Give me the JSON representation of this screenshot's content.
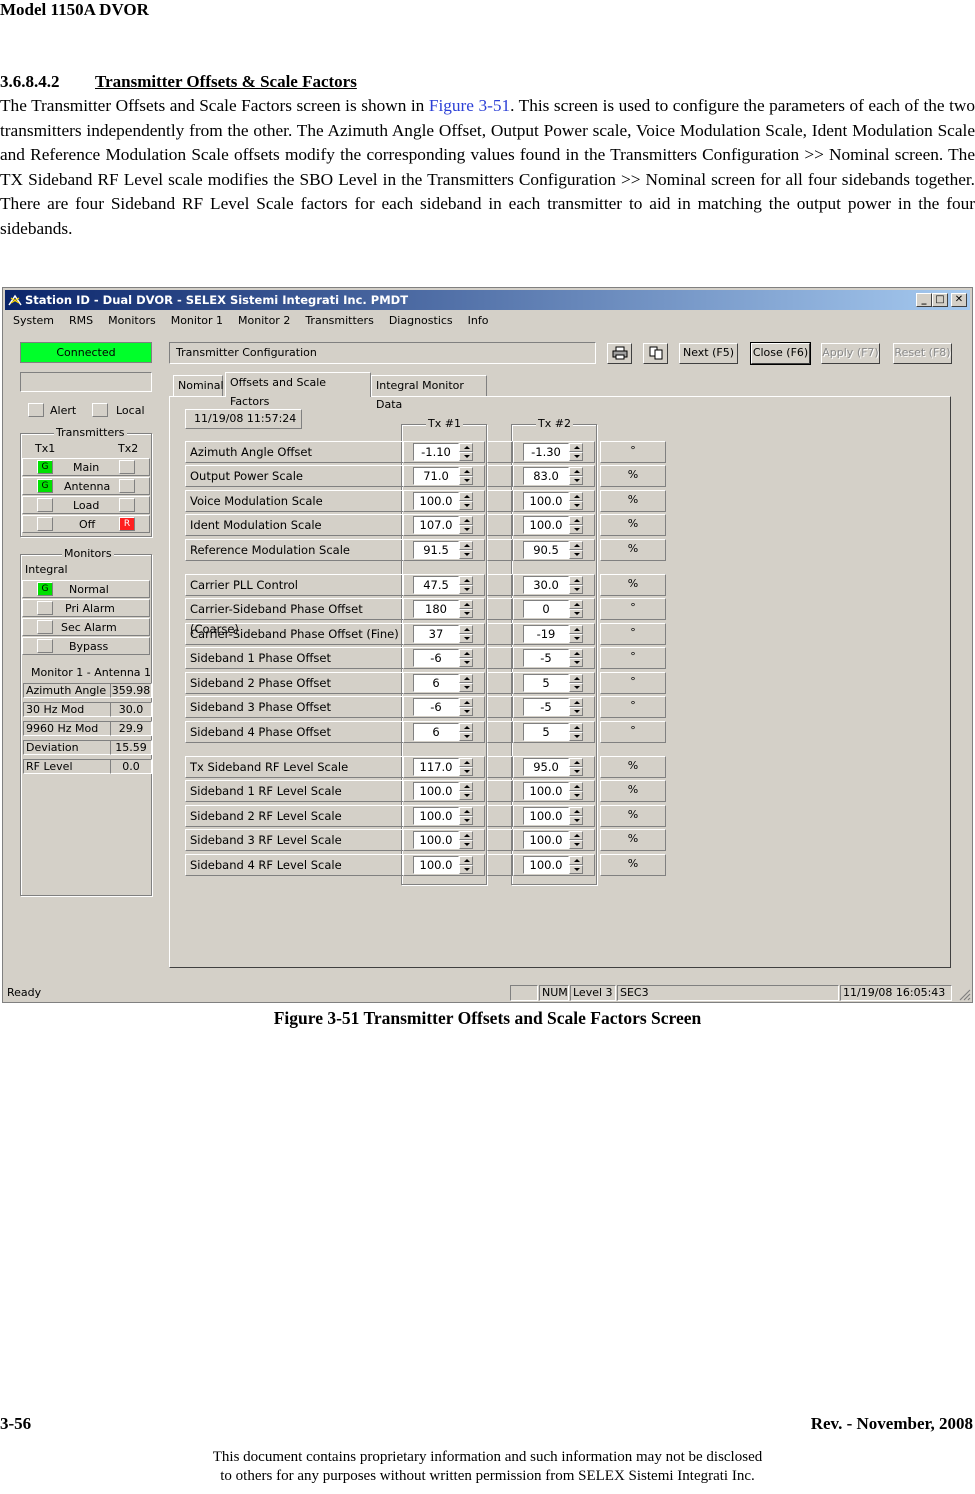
{
  "header": {
    "model": "Model 1150A DVOR"
  },
  "section": {
    "number": "3.6.8.4.2",
    "title": "Transmitter Offsets & Scale Factors",
    "text_before_ref": "The Transmitter Offsets and Scale Factors screen is shown in ",
    "figure_ref": "Figure 3-51",
    "text_after_ref": ". This screen is used to configure the parameters of each of the two transmitters independently from the other. The Azimuth Angle Offset, Output Power scale, Voice Modulation Scale, Ident Modulation Scale and Reference Modulation Scale offsets modify the corresponding values found in the Transmitters Configuration >> Nominal screen. The TX Sideband RF Level scale modifies the SBO Level in the Transmitters Configuration >> Nominal screen for all four sidebands together. There are four Sideband RF Level Scale factors for each sideband in each transmitter to aid in matching the output power in the four sidebands."
  },
  "window": {
    "title": "Station ID - Dual DVOR - SELEX Sistemi Integrati Inc. PMDT",
    "controls": {
      "minimize": "_",
      "maximize": "□",
      "close": "✕"
    },
    "menu": [
      "System",
      "RMS",
      "Monitors",
      "Monitor 1",
      "Monitor 2",
      "Transmitters",
      "Diagnostics",
      "Info"
    ],
    "connection_status": "Connected",
    "alert_label": "Alert",
    "local_label": "Local",
    "transmitters": {
      "title": "Transmitters",
      "tx1": "Tx1",
      "tx2": "Tx2",
      "rows": [
        {
          "label": "Main",
          "tx1": "G",
          "tx2": ""
        },
        {
          "label": "Antenna",
          "tx1": "G",
          "tx2": ""
        },
        {
          "label": "Load",
          "tx1": "",
          "tx2": ""
        },
        {
          "label": "Off",
          "tx1": "",
          "tx2": "R"
        }
      ]
    },
    "monitors": {
      "title": "Monitors",
      "integral": "Integral",
      "rows": [
        {
          "label": "Normal",
          "ind": "G"
        },
        {
          "label": "Pri Alarm",
          "ind": ""
        },
        {
          "label": "Sec Alarm",
          "ind": ""
        },
        {
          "label": "Bypass",
          "ind": ""
        }
      ],
      "subtitle": "Monitor 1 - Antenna 1",
      "readings": [
        {
          "label": "Azimuth Angle",
          "value": "359.98"
        },
        {
          "label": "30 Hz Mod",
          "value": "30.0"
        },
        {
          "label": "9960 Hz Mod",
          "value": "29.9"
        },
        {
          "label": "Deviation",
          "value": "15.59"
        },
        {
          "label": "RF Level",
          "value": "0.0"
        }
      ]
    },
    "breadcrumb": "Transmitter Configuration",
    "toolbar": {
      "print_icon": "printer-icon",
      "copy_icon": "copy-icon",
      "next": "Next (F5)",
      "close": "Close (F6)",
      "apply": "Apply (F7)",
      "reset": "Reset (F8)"
    },
    "tabs": [
      "Nominal",
      "Offsets and Scale Factors",
      "Integral Monitor Data"
    ],
    "timestamp": "11/19/08 11:57:24",
    "tx1_header": "Tx #1",
    "tx2_header": "Tx #2",
    "params": [
      {
        "label": "Azimuth Angle Offset",
        "tx1": "-1.10",
        "tx2": "-1.30",
        "unit": "°"
      },
      {
        "label": "Output Power Scale",
        "tx1": "71.0",
        "tx2": "83.0",
        "unit": "%"
      },
      {
        "label": "Voice Modulation Scale",
        "tx1": "100.0",
        "tx2": "100.0",
        "unit": "%"
      },
      {
        "label": "Ident Modulation Scale",
        "tx1": "107.0",
        "tx2": "100.0",
        "unit": "%"
      },
      {
        "label": "Reference Modulation Scale",
        "tx1": "91.5",
        "tx2": "90.5",
        "unit": "%"
      },
      {
        "label": "Carrier PLL Control",
        "tx1": "47.5",
        "tx2": "30.0",
        "unit": "%"
      },
      {
        "label": "Carrier-Sideband Phase Offset (Coarse)",
        "tx1": "180",
        "tx2": "0",
        "unit": "°"
      },
      {
        "label": "Carrier-Sideband Phase Offset (Fine)",
        "tx1": "37",
        "tx2": "-19",
        "unit": "°"
      },
      {
        "label": "Sideband 1 Phase Offset",
        "tx1": "-6",
        "tx2": "-5",
        "unit": "°"
      },
      {
        "label": "Sideband 2 Phase Offset",
        "tx1": "6",
        "tx2": "5",
        "unit": "°"
      },
      {
        "label": "Sideband 3 Phase Offset",
        "tx1": "-6",
        "tx2": "-5",
        "unit": "°"
      },
      {
        "label": "Sideband 4 Phase Offset",
        "tx1": "6",
        "tx2": "5",
        "unit": "°"
      },
      {
        "label": "Tx Sideband RF Level Scale",
        "tx1": "117.0",
        "tx2": "95.0",
        "unit": "%"
      },
      {
        "label": "Sideband 1 RF Level Scale",
        "tx1": "100.0",
        "tx2": "100.0",
        "unit": "%"
      },
      {
        "label": "Sideband 2 RF Level Scale",
        "tx1": "100.0",
        "tx2": "100.0",
        "unit": "%"
      },
      {
        "label": "Sideband 3 RF Level Scale",
        "tx1": "100.0",
        "tx2": "100.0",
        "unit": "%"
      },
      {
        "label": "Sideband 4 RF Level Scale",
        "tx1": "100.0",
        "tx2": "100.0",
        "unit": "%"
      }
    ],
    "statusbar": {
      "ready": "Ready",
      "num": "NUM",
      "level": "Level 3",
      "sec": "SEC3",
      "datetime": "11/19/08 16:05:43"
    }
  },
  "caption": "Figure 3-51  Transmitter Offsets and Scale Factors Screen",
  "footer": {
    "page": "3-56",
    "revision": "Rev. -  November, 2008",
    "disclaimer_line1": "This document contains proprietary information and such information may not be disclosed",
    "disclaimer_line2": "to others for any purposes without written permission from SELEX Sistemi Integrati Inc."
  },
  "colors": {
    "connected": "#00ff2a",
    "green_indicator": "#00e000",
    "red_indicator": "#ff2020",
    "title_bar": "#0a246a",
    "figure_ref": "#2b3fd6"
  }
}
